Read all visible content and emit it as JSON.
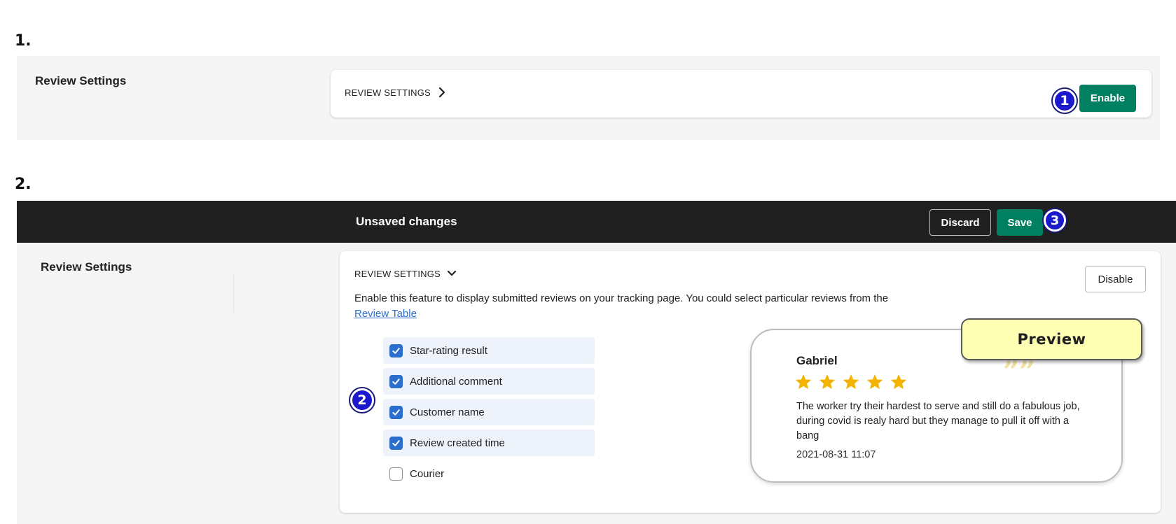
{
  "steps": {
    "one": "1.",
    "two": "2."
  },
  "section1": {
    "title": "Review Settings",
    "card_header": "REVIEW SETTINGS",
    "enable_label": "Enable",
    "badge": "1"
  },
  "section2": {
    "topbar_title": "Unsaved changes",
    "discard_label": "Discard",
    "save_label": "Save",
    "save_badge": "3",
    "title": "Review Settings",
    "card_header": "REVIEW SETTINGS",
    "disable_label": "Disable",
    "description": "Enable this feature to display submitted reviews on your tracking page. You could select particular reviews from the",
    "review_table_link": "Review Table",
    "options_badge": "2",
    "options": [
      {
        "label": "Star-rating result",
        "checked": true
      },
      {
        "label": "Additional comment",
        "checked": true
      },
      {
        "label": "Customer name",
        "checked": true
      },
      {
        "label": "Review created time",
        "checked": true
      },
      {
        "label": "Courier",
        "checked": false
      }
    ],
    "preview": {
      "tag": "Preview",
      "reviewer": "Gabriel",
      "rating": 5,
      "text": "The worker try their hardest to serve and still do a fabulous job, during covid is realy hard but they manage to pull it off with a bang",
      "date": "2021-08-31 11:07",
      "star_color": "#f5b301"
    }
  },
  "colors": {
    "primary_green": "#008060",
    "checkbox_blue": "#2c6ecb",
    "badge_blue": "#1a1acc",
    "topbar": "#202020"
  }
}
